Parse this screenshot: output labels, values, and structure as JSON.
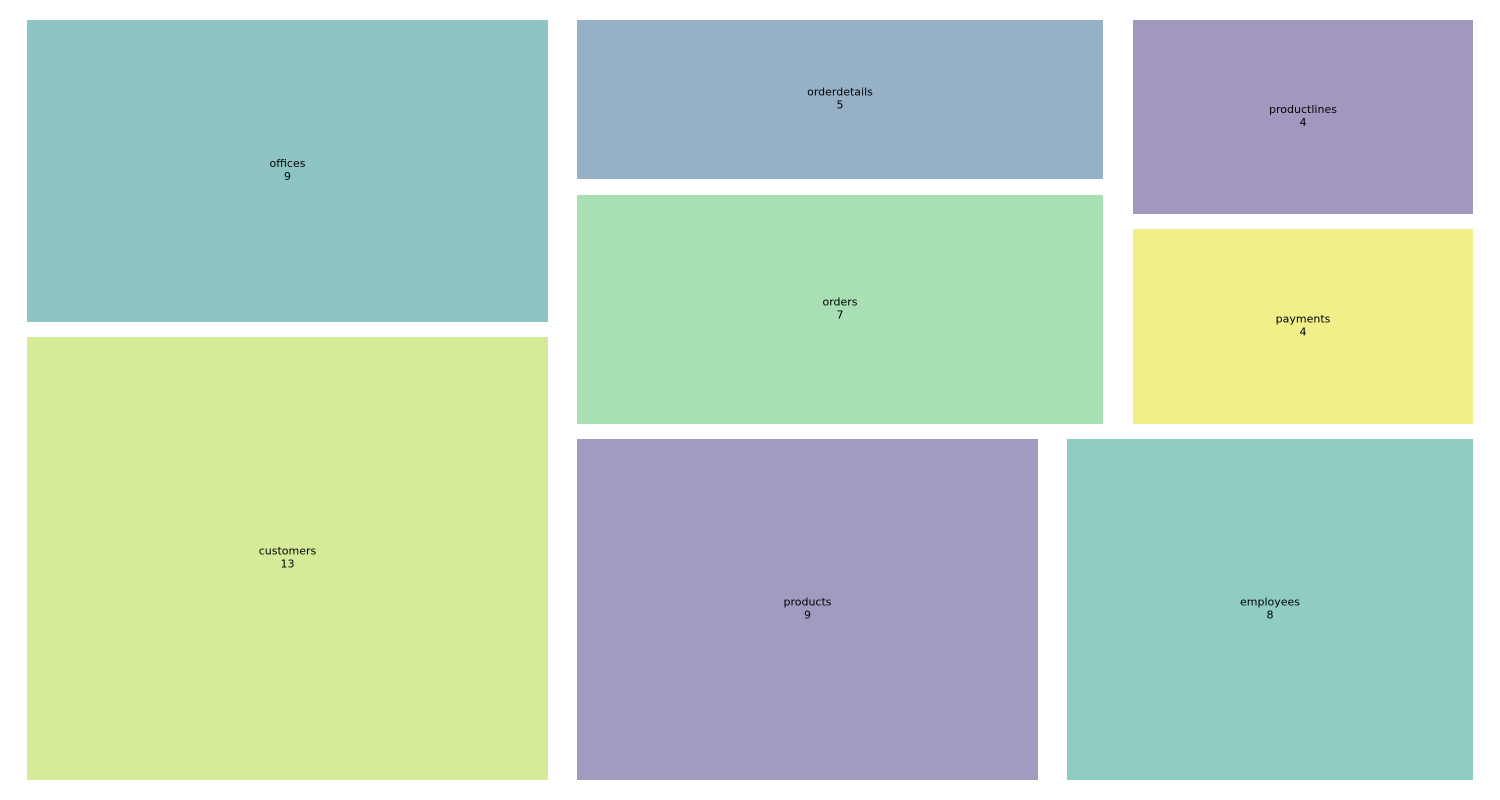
{
  "chart_data": {
    "type": "treemap",
    "title": "",
    "items": [
      {
        "label": "offices",
        "value": 9,
        "color": "#8fc4c4"
      },
      {
        "label": "customers",
        "value": 13,
        "color": "#d6eb97"
      },
      {
        "label": "orderdetails",
        "value": 5,
        "color": "#96b0c5"
      },
      {
        "label": "orders",
        "value": 7,
        "color": "#a8e0b4"
      },
      {
        "label": "productlines",
        "value": 4,
        "color": "#a197bf"
      },
      {
        "label": "payments",
        "value": 4,
        "color": "#f0ef8a"
      },
      {
        "label": "products",
        "value": 9,
        "color": "#a29bbf"
      },
      {
        "label": "employees",
        "value": 8,
        "color": "#8fcdc2"
      }
    ]
  }
}
